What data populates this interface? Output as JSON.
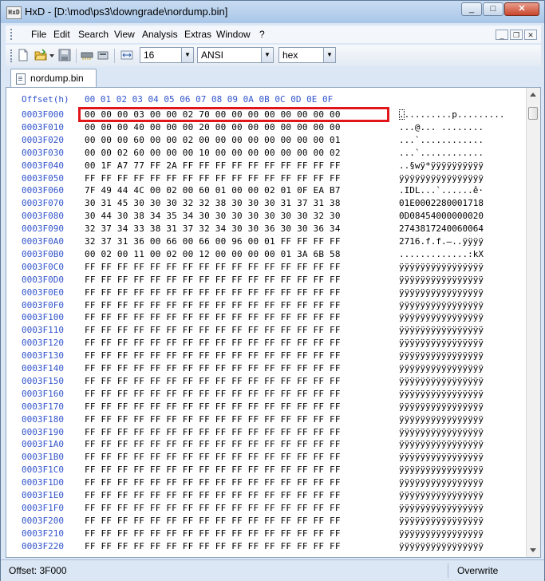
{
  "window": {
    "title": "HxD - [D:\\mod\\ps3\\downgrade\\nordump.bin]",
    "icon_text": "HxD",
    "minimize": "_",
    "maximize": "□",
    "close": "✕"
  },
  "menu": {
    "items": [
      "File",
      "Edit",
      "Search",
      "View",
      "Analysis",
      "Extras",
      "Window",
      "?"
    ]
  },
  "toolbar": {
    "bytes_per_row": "16",
    "charset": "ANSI",
    "offset_base": "hex"
  },
  "tab": {
    "label": "nordump.bin"
  },
  "editor": {
    "offset_header": "Offset(h)",
    "column_headers": "00 01 02 03 04 05 06 07 08 09 0A 0B 0C 0D 0E 0F",
    "rows": [
      {
        "offset": "0003F000",
        "hex": "00 00 00 03 00 00 02 70 00 00 00 00 00 00 00 00",
        "text": "..........p........."
      },
      {
        "offset": "0003F010",
        "hex": "00 00 00 40 00 00 00 20 00 00 00 00 00 00 00 00",
        "text": "...@... ........"
      },
      {
        "offset": "0003F020",
        "hex": "00 00 00 60 00 00 02 00 00 00 00 00 00 00 00 01",
        "text": "...`............"
      },
      {
        "offset": "0003F030",
        "hex": "00 00 02 60 00 00 00 10 00 00 00 00 00 00 00 02",
        "text": "...`............"
      },
      {
        "offset": "0003F040",
        "hex": "00 1F A7 77 FF 2A FF FF FF FF FF FF FF FF FF FF",
        "text": "..§wÿ*ÿÿÿÿÿÿÿÿÿÿ"
      },
      {
        "offset": "0003F050",
        "hex": "FF FF FF FF FF FF FF FF FF FF FF FF FF FF FF FF",
        "text": "ÿÿÿÿÿÿÿÿÿÿÿÿÿÿÿÿ"
      },
      {
        "offset": "0003F060",
        "hex": "7F 49 44 4C 00 02 00 60 01 00 00 02 01 0F EA B7",
        "text": ".IDL...`......ê·"
      },
      {
        "offset": "0003F070",
        "hex": "30 31 45 30 30 30 32 32 38 30 30 30 31 37 31 38",
        "text": "01E0002280001718"
      },
      {
        "offset": "0003F080",
        "hex": "30 44 30 38 34 35 34 30 30 30 30 30 30 30 32 30",
        "text": "0D08454000000020"
      },
      {
        "offset": "0003F090",
        "hex": "32 37 34 33 38 31 37 32 34 30 30 36 30 30 36 34",
        "text": "2743817240060064"
      },
      {
        "offset": "0003F0A0",
        "hex": "32 37 31 36 00 66 00 66 00 96 00 01 FF FF FF FF",
        "text": "2716.f.f.–..ÿÿÿÿ"
      },
      {
        "offset": "0003F0B0",
        "hex": "00 02 00 11 00 02 00 12 00 00 00 00 01 3A 6B 58",
        "text": ".............:kX"
      },
      {
        "offset": "0003F0C0",
        "hex": "FF FF FF FF FF FF FF FF FF FF FF FF FF FF FF FF",
        "text": "ÿÿÿÿÿÿÿÿÿÿÿÿÿÿÿÿ"
      },
      {
        "offset": "0003F0D0",
        "hex": "FF FF FF FF FF FF FF FF FF FF FF FF FF FF FF FF",
        "text": "ÿÿÿÿÿÿÿÿÿÿÿÿÿÿÿÿ"
      },
      {
        "offset": "0003F0E0",
        "hex": "FF FF FF FF FF FF FF FF FF FF FF FF FF FF FF FF",
        "text": "ÿÿÿÿÿÿÿÿÿÿÿÿÿÿÿÿ"
      },
      {
        "offset": "0003F0F0",
        "hex": "FF FF FF FF FF FF FF FF FF FF FF FF FF FF FF FF",
        "text": "ÿÿÿÿÿÿÿÿÿÿÿÿÿÿÿÿ"
      },
      {
        "offset": "0003F100",
        "hex": "FF FF FF FF FF FF FF FF FF FF FF FF FF FF FF FF",
        "text": "ÿÿÿÿÿÿÿÿÿÿÿÿÿÿÿÿ"
      },
      {
        "offset": "0003F110",
        "hex": "FF FF FF FF FF FF FF FF FF FF FF FF FF FF FF FF",
        "text": "ÿÿÿÿÿÿÿÿÿÿÿÿÿÿÿÿ"
      },
      {
        "offset": "0003F120",
        "hex": "FF FF FF FF FF FF FF FF FF FF FF FF FF FF FF FF",
        "text": "ÿÿÿÿÿÿÿÿÿÿÿÿÿÿÿÿ"
      },
      {
        "offset": "0003F130",
        "hex": "FF FF FF FF FF FF FF FF FF FF FF FF FF FF FF FF",
        "text": "ÿÿÿÿÿÿÿÿÿÿÿÿÿÿÿÿ"
      },
      {
        "offset": "0003F140",
        "hex": "FF FF FF FF FF FF FF FF FF FF FF FF FF FF FF FF",
        "text": "ÿÿÿÿÿÿÿÿÿÿÿÿÿÿÿÿ"
      },
      {
        "offset": "0003F150",
        "hex": "FF FF FF FF FF FF FF FF FF FF FF FF FF FF FF FF",
        "text": "ÿÿÿÿÿÿÿÿÿÿÿÿÿÿÿÿ"
      },
      {
        "offset": "0003F160",
        "hex": "FF FF FF FF FF FF FF FF FF FF FF FF FF FF FF FF",
        "text": "ÿÿÿÿÿÿÿÿÿÿÿÿÿÿÿÿ"
      },
      {
        "offset": "0003F170",
        "hex": "FF FF FF FF FF FF FF FF FF FF FF FF FF FF FF FF",
        "text": "ÿÿÿÿÿÿÿÿÿÿÿÿÿÿÿÿ"
      },
      {
        "offset": "0003F180",
        "hex": "FF FF FF FF FF FF FF FF FF FF FF FF FF FF FF FF",
        "text": "ÿÿÿÿÿÿÿÿÿÿÿÿÿÿÿÿ"
      },
      {
        "offset": "0003F190",
        "hex": "FF FF FF FF FF FF FF FF FF FF FF FF FF FF FF FF",
        "text": "ÿÿÿÿÿÿÿÿÿÿÿÿÿÿÿÿ"
      },
      {
        "offset": "0003F1A0",
        "hex": "FF FF FF FF FF FF FF FF FF FF FF FF FF FF FF FF",
        "text": "ÿÿÿÿÿÿÿÿÿÿÿÿÿÿÿÿ"
      },
      {
        "offset": "0003F1B0",
        "hex": "FF FF FF FF FF FF FF FF FF FF FF FF FF FF FF FF",
        "text": "ÿÿÿÿÿÿÿÿÿÿÿÿÿÿÿÿ"
      },
      {
        "offset": "0003F1C0",
        "hex": "FF FF FF FF FF FF FF FF FF FF FF FF FF FF FF FF",
        "text": "ÿÿÿÿÿÿÿÿÿÿÿÿÿÿÿÿ"
      },
      {
        "offset": "0003F1D0",
        "hex": "FF FF FF FF FF FF FF FF FF FF FF FF FF FF FF FF",
        "text": "ÿÿÿÿÿÿÿÿÿÿÿÿÿÿÿÿ"
      },
      {
        "offset": "0003F1E0",
        "hex": "FF FF FF FF FF FF FF FF FF FF FF FF FF FF FF FF",
        "text": "ÿÿÿÿÿÿÿÿÿÿÿÿÿÿÿÿ"
      },
      {
        "offset": "0003F1F0",
        "hex": "FF FF FF FF FF FF FF FF FF FF FF FF FF FF FF FF",
        "text": "ÿÿÿÿÿÿÿÿÿÿÿÿÿÿÿÿ"
      },
      {
        "offset": "0003F200",
        "hex": "FF FF FF FF FF FF FF FF FF FF FF FF FF FF FF FF",
        "text": "ÿÿÿÿÿÿÿÿÿÿÿÿÿÿÿÿ"
      },
      {
        "offset": "0003F210",
        "hex": "FF FF FF FF FF FF FF FF FF FF FF FF FF FF FF FF",
        "text": "ÿÿÿÿÿÿÿÿÿÿÿÿÿÿÿÿ"
      },
      {
        "offset": "0003F220",
        "hex": "FF FF FF FF FF FF FF FF FF FF FF FF FF FF FF FF",
        "text": "ÿÿÿÿÿÿÿÿÿÿÿÿÿÿÿÿ"
      }
    ]
  },
  "status": {
    "offset": "Offset: 3F000",
    "mode": "Overwrite"
  },
  "colors": {
    "offset_blue": "#3355cc",
    "highlight_red": "#e0161b"
  }
}
